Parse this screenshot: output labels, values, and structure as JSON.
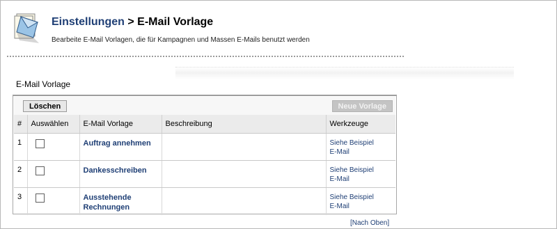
{
  "header": {
    "breadcrumb_parent": "Einstellungen",
    "separator": " > ",
    "title": "E-Mail Vorlage",
    "subtitle": "Bearbeite E-Mail Vorlagen, die für Kampagnen und Massen E-Mails benutzt werden",
    "icon": "email-template-icon"
  },
  "section": {
    "title": "E-Mail Vorlage"
  },
  "toolbar": {
    "delete_label": "Löschen",
    "new_label": "Neue Vorlage"
  },
  "table": {
    "columns": [
      "#",
      "Auswählen",
      "E-Mail Vorlage",
      "Beschreibung",
      "Werkzeuge"
    ],
    "rows": [
      {
        "num": "1",
        "name": "Auftrag annehmen",
        "description": "",
        "tool_line1": "Siehe Beispiel",
        "tool_line2": "E-Mail"
      },
      {
        "num": "2",
        "name": "Dankesschreiben",
        "description": "",
        "tool_line1": "Siehe Beispiel",
        "tool_line2": "E-Mail"
      },
      {
        "num": "3",
        "name": "Ausstehende Rechnungen",
        "description": "",
        "tool_line1": "Siehe Beispiel",
        "tool_line2": "E-Mail"
      }
    ]
  },
  "footer": {
    "back_to_top": "[Nach Oben]"
  },
  "colors": {
    "link": "#1f3f75",
    "header_bg": "#ebebeb",
    "border": "#a7a7a7"
  }
}
